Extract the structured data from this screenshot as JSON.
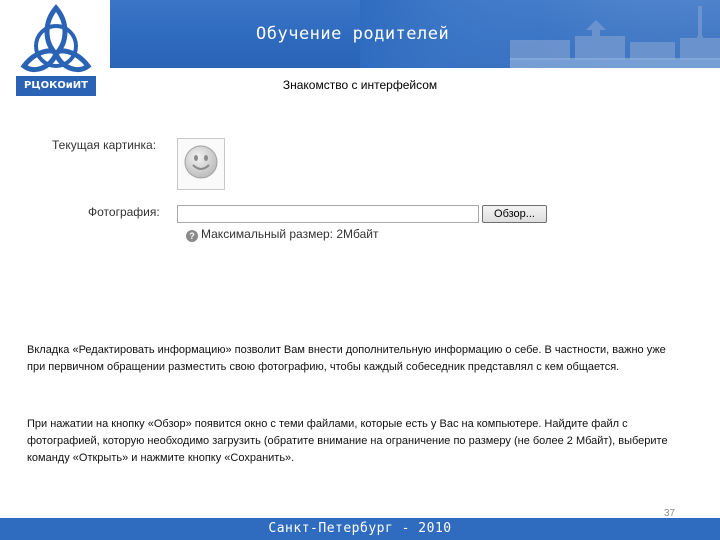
{
  "header": {
    "title": "Обучение родителей",
    "logo_text": "РЦОКОиИТ"
  },
  "slide": {
    "subtitle": "Знакомство с интерфейсом"
  },
  "form": {
    "current_picture_label": "Текущая картинка:",
    "photo_label": "Фотография:",
    "file_input_value": "",
    "browse_button_label": "Обзор...",
    "help_icon_glyph": "?",
    "max_size_hint": "Максимальный размер: 2Мбайт"
  },
  "body": {
    "paragraph1": "Вкладка «Редактировать информацию» позволит Вам внести дополнительную информацию о себе. В частности, важно уже при первичном обращении разместить свою фотографию, чтобы каждый собеседник представлял с кем общается.",
    "paragraph2": "При нажатии на кнопку «Обзор» появится окно с теми файлами, которые есть у Вас на компьютере. Найдите файл с фотографией, которую необходимо загрузить (обратите внимание на ограничение по размеру (не более 2 Мбайт), выберите команду «Открыть» и нажмите кнопку «Сохранить»."
  },
  "footer": {
    "text": "Санкт-Петербург - 2010",
    "page_number": "37"
  },
  "colors": {
    "banner_blue": "#2f6bbf",
    "logo_blue": "#2a63b6"
  },
  "icons": [
    "logo-trefoil-icon",
    "smiley-avatar-icon",
    "help-icon"
  ]
}
